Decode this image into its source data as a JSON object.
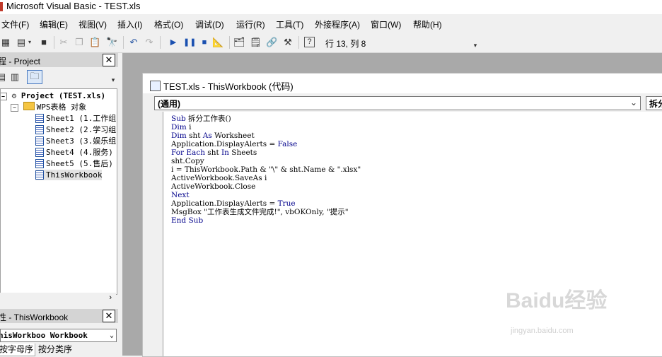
{
  "window": {
    "title": "Microsoft Visual Basic - TEST.xls"
  },
  "menu": [
    "文件(F)",
    "编辑(E)",
    "视图(V)",
    "插入(I)",
    "格式(O)",
    "调试(D)",
    "运行(R)",
    "工具(T)",
    "外接程序(A)",
    "窗口(W)",
    "帮助(H)"
  ],
  "toolbar": {
    "position_text": "行 13, 列 8"
  },
  "project_pane": {
    "title": "程 - Project",
    "root": "Project (TEST.xls)",
    "folder": "WPS表格 对象",
    "items": [
      "Sheet1 (1.工作组",
      "Sheet2 (2.学习组",
      "Sheet3 (3.娱乐组",
      "Sheet4 (4.服务)",
      "Sheet5 (5.售后)",
      "ThisWorkbook"
    ]
  },
  "properties_pane": {
    "title": "性 - ThisWorkbook",
    "object_combo": "hisWorkboo Workbook",
    "tabs": [
      "按字母序",
      "按分类序"
    ]
  },
  "code_window": {
    "title": "TEST.xls - ThisWorkbook (代码)",
    "object_combo": "(通用)",
    "proc_combo": "拆分",
    "lines": [
      "Sub 拆分工作表()",
      "Dim i",
      "Dim sht As Worksheet",
      "Application.DisplayAlerts = False",
      "For Each sht In Sheets",
      "sht.Copy",
      "i = ThisWorkbook.Path & \"\\\" & sht.Name & \".xlsx\"",
      "ActiveWorkbook.SaveAs i",
      "ActiveWorkbook.Close",
      "Next",
      "Application.DisplayAlerts = True",
      "MsgBox \"工作表生成文件完成!\", vbOKOnly, \"提示\"",
      "End Sub"
    ]
  },
  "watermark": {
    "brand": "Baidu经验",
    "url": "jingyan.baidu.com"
  },
  "colors": {
    "keyword": "#00008b",
    "mdi_background": "#a9a9a9"
  }
}
